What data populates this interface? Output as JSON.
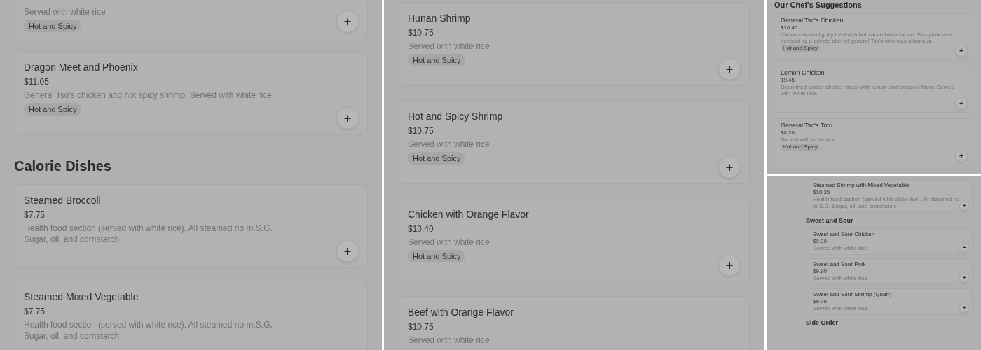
{
  "panels": [
    {
      "blocks": [
        {
          "kind": "card",
          "description": "Served with white rice",
          "tag": "Hot and Spicy",
          "add": "+"
        },
        {
          "kind": "card",
          "name": "Dragon Meet and Phoenix",
          "price": "$11.05",
          "description": "General Tso's chicken and hot spicy shrimp. Served with white rice.",
          "tag": "Hot and Spicy",
          "add": "+"
        },
        {
          "kind": "heading",
          "text": "Calorie Dishes"
        },
        {
          "kind": "card",
          "name": "Steamed Broccoli",
          "price": "$7.75",
          "description": "Health food section (served with white rice). All steamed no m.S.G. Sugar, oil, and cornstarch",
          "add": "+"
        },
        {
          "kind": "card",
          "name": "Steamed Mixed Vegetable",
          "price": "$7.75",
          "description": "Health food section (served with white rice). All steamed no m.S.G. Sugar, oil, and cornstarch"
        }
      ]
    },
    {
      "blocks": [
        {
          "kind": "card",
          "name": "Hunan Shrimp",
          "price": "$10.75",
          "description": "Served with white rice",
          "tag": "Hot and Spicy",
          "add": "+"
        },
        {
          "kind": "card",
          "name": "Hot and Spicy Shrimp",
          "price": "$10.75",
          "description": "Served with white rice",
          "tag": "Hot and Spicy",
          "add": "+"
        },
        {
          "kind": "card",
          "name": "Chicken with Orange Flavor",
          "price": "$10.40",
          "description": "Served with white rice",
          "tag": "Hot and Spicy",
          "add": "+"
        },
        {
          "kind": "card",
          "name": "Beef with Orange Flavor",
          "price": "$10.75",
          "description": "Served with white rice"
        }
      ]
    },
    {
      "blocks": [
        {
          "kind": "heading",
          "text": "Our Chef's Suggestions"
        },
        {
          "kind": "card",
          "name": "General Tso's Chicken",
          "price": "$10.40",
          "description": "Chunk chicken lightly fried with hot sauce bean sauce. This plate was devised by a private chef of general Tso's who was a famous...",
          "tag": "Hot and Spicy",
          "add": "+"
        },
        {
          "kind": "card",
          "name": "Lemon Chicken",
          "price": "$9.45",
          "description": "Deen fried tender chicken meat with lemon and broccoli flavor. Served with white rice.",
          "add": "+"
        },
        {
          "kind": "card",
          "name": "General Tso's Tofu",
          "price": "$8.20",
          "description": "Served with white rice",
          "tag": "Hot and Spicy",
          "add": "+"
        }
      ]
    },
    {
      "blocks": [
        {
          "kind": "card",
          "name": "Steamed Shrimp with Mixed Vegetable",
          "price": "$10.35",
          "description": "Health food section (served with white rice). All steamed no m.S.G. Sugar, oil, and cornstarch",
          "add": "+"
        },
        {
          "kind": "heading",
          "text": "Sweet and Sour"
        },
        {
          "kind": "card",
          "name": "Sweet and Sour Chicken",
          "price": "$9.90",
          "description": "Served with white rice",
          "add": "+"
        },
        {
          "kind": "card",
          "name": "Sweet and Sour Pork",
          "price": "$9.90",
          "description": "Served with white rice",
          "add": "+"
        },
        {
          "kind": "card",
          "name": "Sweet and Sour Shrimp (Quart)",
          "price": "$9.75",
          "description": "Served with white rice",
          "add": "+"
        },
        {
          "kind": "heading",
          "text": "Side Order"
        }
      ]
    }
  ]
}
